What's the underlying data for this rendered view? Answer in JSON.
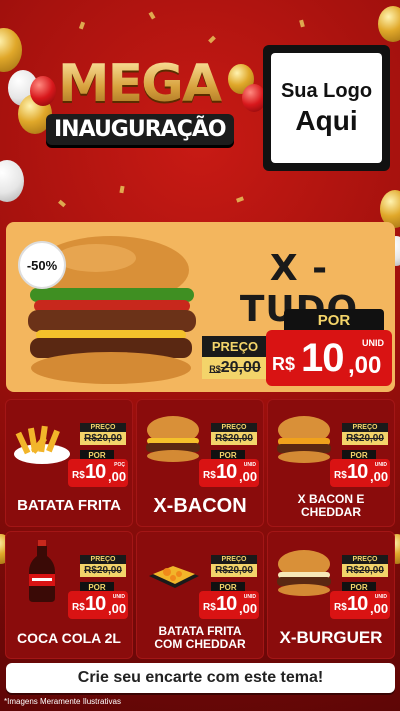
{
  "headline": {
    "line1": "MEGA",
    "line2": "INAUGURAÇÃO"
  },
  "logo": {
    "line1": "Sua Logo",
    "line2": "Aqui"
  },
  "hero": {
    "discount": "-50%",
    "name": "X - TUDO",
    "preco_label": "PREÇO",
    "old_prefix": "R$",
    "old_price": "20,00",
    "por_label": "POR",
    "currency": "R$",
    "price_int": "10",
    "price_cents": ",00",
    "unit": "UNID"
  },
  "products": [
    {
      "name": "BATATA FRITA",
      "icon": "fries-icon",
      "preco_label": "PREÇO",
      "old_price": "R$20,00",
      "por_label": "POR",
      "currency": "R$",
      "price_int": "10",
      "price_cents": ",00",
      "unit": "POÇ"
    },
    {
      "name": "X-BACON",
      "icon": "burger-icon",
      "preco_label": "PREÇO",
      "old_price": "R$20,00",
      "por_label": "POR",
      "currency": "R$",
      "price_int": "10",
      "price_cents": ",00",
      "unit": "UNID"
    },
    {
      "name": "X BACON E CHEDDAR",
      "icon": "burger-icon",
      "preco_label": "PREÇO",
      "old_price": "R$20,00",
      "por_label": "POR",
      "currency": "R$",
      "price_int": "10",
      "price_cents": ",00",
      "unit": "UNID"
    },
    {
      "name": "COCA COLA 2L",
      "icon": "soda-bottle-icon",
      "preco_label": "PREÇO",
      "old_price": "R$20,00",
      "por_label": "POR",
      "currency": "R$",
      "price_int": "10",
      "price_cents": ",00",
      "unit": "UNID"
    },
    {
      "name": "BATATA FRITA COM CHEDDAR",
      "icon": "fries-cheddar-icon",
      "preco_label": "PREÇO",
      "old_price": "R$20,00",
      "por_label": "POR",
      "currency": "R$",
      "price_int": "10",
      "price_cents": ",00",
      "unit": "UNID"
    },
    {
      "name": "X-BURGUER",
      "icon": "burger-icon",
      "preco_label": "PREÇO",
      "old_price": "R$20,00",
      "por_label": "POR",
      "currency": "R$",
      "price_int": "10",
      "price_cents": ",00",
      "unit": "UNID"
    }
  ],
  "cta": "Crie seu encarte com este tema!",
  "footnote": "*Imagens Meramente Ilustrativas",
  "colors": {
    "background": "#9c0f0c",
    "hero_bg": "#f3b65e",
    "price_red": "#d91313",
    "gold": "#f3d46a",
    "dark": "#1a1a1a"
  }
}
